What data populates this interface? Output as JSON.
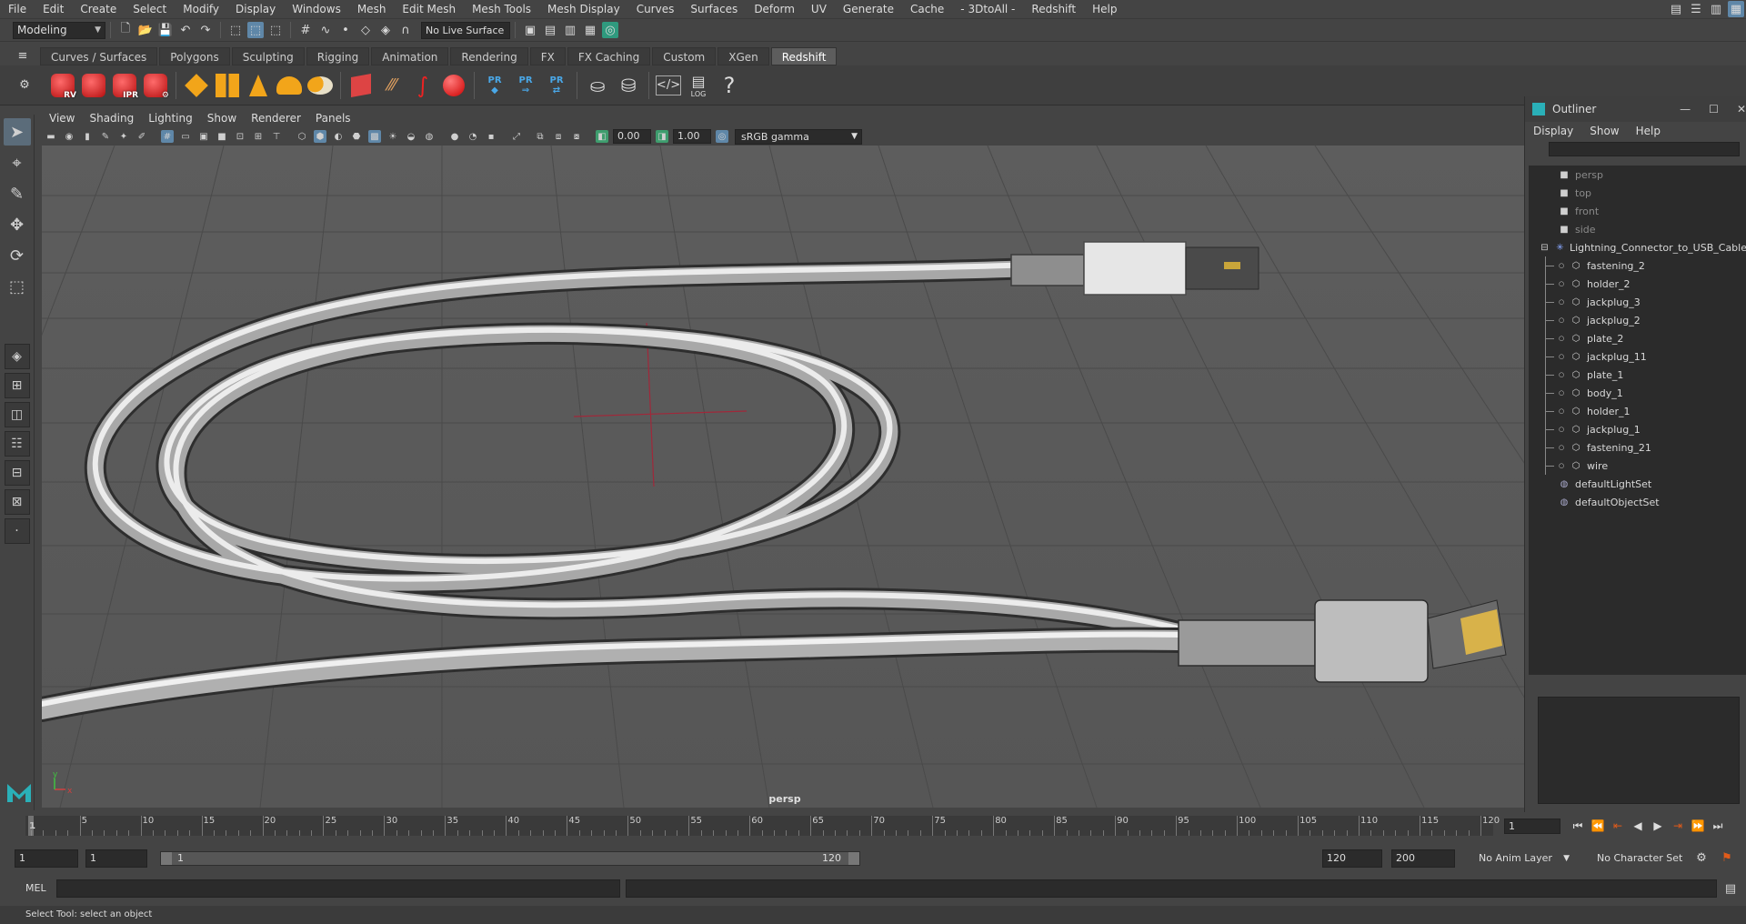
{
  "menubar": {
    "items": [
      "File",
      "Edit",
      "Create",
      "Select",
      "Modify",
      "Display",
      "Windows",
      "Mesh",
      "Edit Mesh",
      "Mesh Tools",
      "Mesh Display",
      "Curves",
      "Surfaces",
      "Deform",
      "UV",
      "Generate",
      "Cache",
      "- 3DtoAll -",
      "Redshift",
      "Help"
    ]
  },
  "statusline": {
    "mode": "Modeling",
    "live_surface": "No Live Surface"
  },
  "shelf_tabs": {
    "items": [
      "Curves / Surfaces",
      "Polygons",
      "Sculpting",
      "Rigging",
      "Animation",
      "Rendering",
      "FX",
      "FX Caching",
      "Custom",
      "XGen",
      "Redshift"
    ],
    "active": "Redshift"
  },
  "shelf": {
    "rv_label": "RV",
    "ipr_label": "IPR",
    "pr_label": "PR",
    "log_label": "LOG",
    "help_glyph": "?"
  },
  "viewport": {
    "menu": [
      "View",
      "Shading",
      "Lighting",
      "Show",
      "Renderer",
      "Panels"
    ],
    "exposure": "0.00",
    "gamma_value": "1.00",
    "color_space": "sRGB gamma",
    "camera": "persp",
    "axis_x": "x",
    "axis_y": "y"
  },
  "outliner": {
    "title": "Outliner",
    "menu": [
      "Display",
      "Show",
      "Help"
    ],
    "cameras": [
      "persp",
      "top",
      "front",
      "side"
    ],
    "group": "Lightning_Connector_to_USB_Cable",
    "children": [
      "fastening_2",
      "holder_2",
      "jackplug_3",
      "jackplug_2",
      "plate_2",
      "jackplug_11",
      "plate_1",
      "body_1",
      "holder_1",
      "jackplug_1",
      "fastening_21",
      "wire"
    ],
    "sets": [
      "defaultLightSet",
      "defaultObjectSet"
    ]
  },
  "timeslider": {
    "start_marker": "1",
    "ticks": [
      "5",
      "10",
      "15",
      "20",
      "25",
      "30",
      "35",
      "40",
      "45",
      "50",
      "55",
      "60",
      "65",
      "70",
      "75",
      "80",
      "85",
      "90",
      "95",
      "100",
      "105",
      "110",
      "115",
      "120"
    ],
    "current_frame": "1"
  },
  "rangeslider": {
    "start": "1",
    "playback_start": "1",
    "range_start": "1",
    "range_end": "120",
    "playback_end": "120",
    "end": "200",
    "anim_layer": "No Anim Layer",
    "character_set": "No Character Set"
  },
  "cmdline": {
    "language": "MEL"
  },
  "helpline": {
    "text": "Select Tool: select an object"
  }
}
